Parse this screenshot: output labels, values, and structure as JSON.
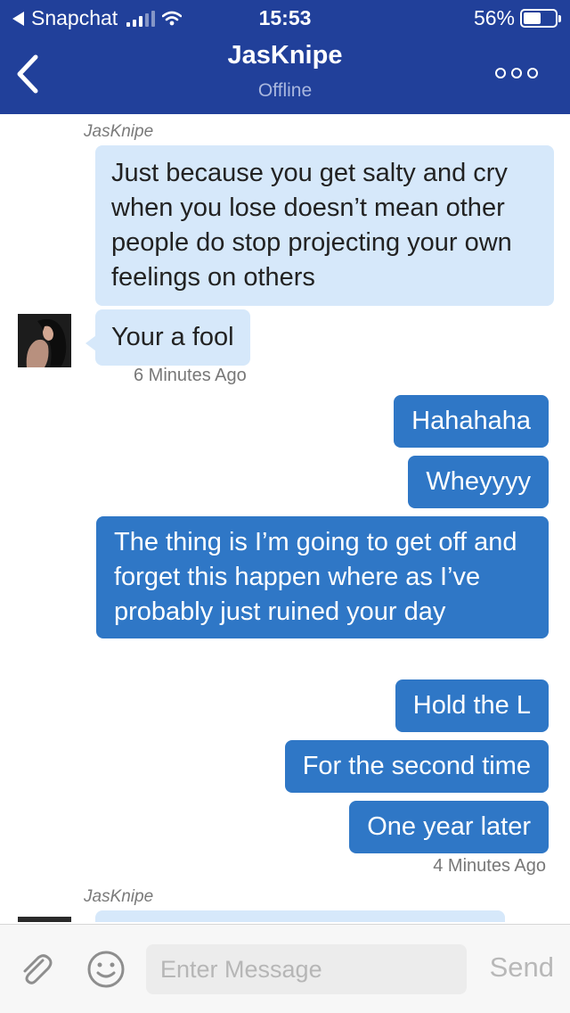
{
  "status_bar": {
    "back_app": "Snapchat",
    "time": "15:53",
    "battery_text": "56%",
    "battery_level": 0.56
  },
  "nav": {
    "title": "JasKnipe",
    "subtitle": "Offline"
  },
  "messages": [
    {
      "sender": "JasKnipe"
    },
    {
      "text": "Just because you get salty and cry when you lose doesn’t mean other people do stop projecting your own feelings on others"
    },
    {
      "text": "Your a fool",
      "time": "6 Minutes Ago"
    },
    {
      "text": "Hahahaha"
    },
    {
      "text": "Wheyyyy"
    },
    {
      "text": "The thing is I’m going to get off and forget this happen where as I’ve probably just ruined your day"
    },
    {
      "text": "Hold the L"
    },
    {
      "text": "For the second time"
    },
    {
      "text": "One year later",
      "time": "4 Minutes Ago"
    },
    {
      "sender": "JasKnipe"
    }
  ],
  "input": {
    "placeholder": "Enter Message",
    "send_label": "Send"
  },
  "colors": {
    "header": "#21409a",
    "incoming_bubble": "#d6e8fa",
    "outgoing_bubble": "#2f77c6"
  }
}
